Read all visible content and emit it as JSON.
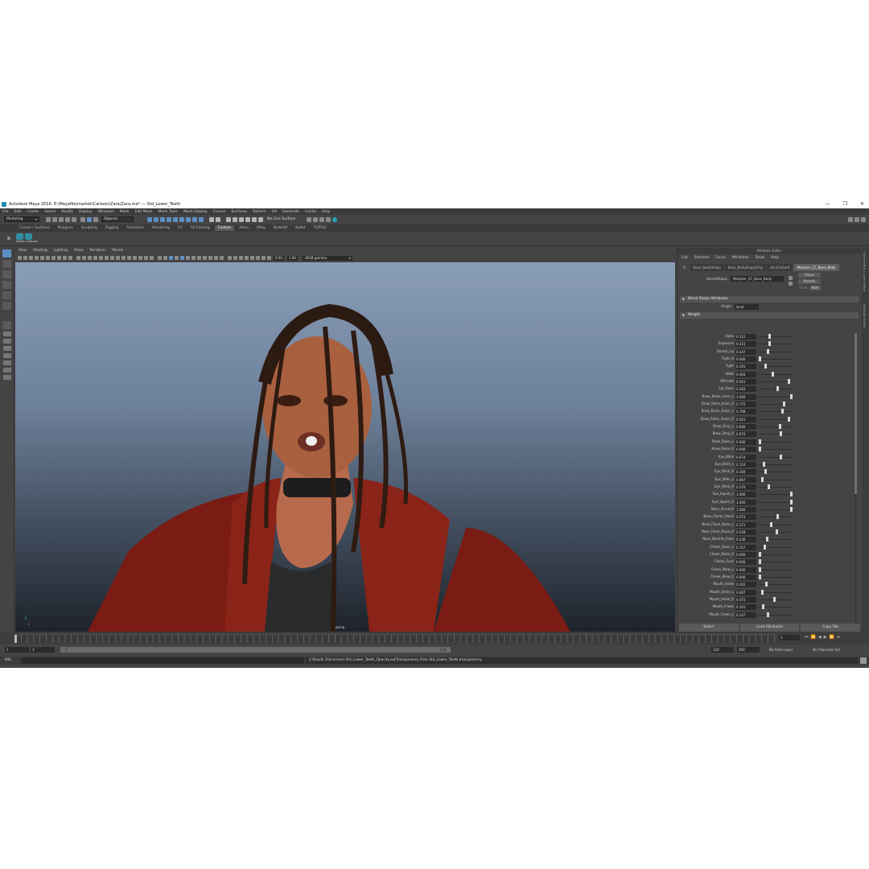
{
  "window": {
    "title": "Autodesk Maya 2016: E:\\Mayafile\\market\\Cartoon\\Zara\\Zara.ma*   ---   Std_Lower_Teeth",
    "controls": [
      "—",
      "❐",
      "✕"
    ]
  },
  "menubar": [
    "File",
    "Edit",
    "Create",
    "Select",
    "Modify",
    "Display",
    "Windows",
    "Mesh",
    "Edit Mesh",
    "Mesh Tools",
    "Mesh Display",
    "Curves",
    "Surfaces",
    "Deform",
    "UV",
    "Generate",
    "Cache",
    "Help"
  ],
  "statusline": {
    "mode": "Modeling",
    "objects": "Objects",
    "live_surface": "No Live Surface"
  },
  "shelf_tabs": [
    "Curves / Surfaces",
    "Polygons",
    "Sculpting",
    "Rigging",
    "Animation",
    "Rendering",
    "FX",
    "FX Caching",
    "Custom",
    "XGen",
    "VRay",
    "Redshift",
    "Bullet",
    "TURTLE"
  ],
  "shelf_active": "Custom",
  "shelf_button": "Select a Mouse",
  "viewport": {
    "menu": [
      "View",
      "Shading",
      "Lighting",
      "Show",
      "Renderer",
      "Panels"
    ],
    "field_a": "0.00",
    "field_b": "1.00",
    "color_mgmt": "sRGB gamma",
    "camera": "persp",
    "axis_x": "x",
    "axis_y": "y"
  },
  "attribute_editor": {
    "header": "Attribute Editor",
    "menu": [
      "List",
      "Selected",
      "Focus",
      "Attributes",
      "Show",
      "Help"
    ],
    "tabs": [
      "Base_BodyShape",
      "Base_BodyShapeOrig",
      "skinCluster4",
      "Morpher_CC_Base_Body"
    ],
    "active_tab": "Morpher_CC_Base_Body",
    "tab_prefix": "fs",
    "blendshape_label": "blendShape:",
    "blendshape_value": "Morpher_CC_Base_Body",
    "buttons": [
      "Focus",
      "Presets"
    ],
    "show_label": "Show",
    "hide_label": "Hide",
    "section_attrs": "Blend Shape Attributes",
    "origin_label": "Origin",
    "origin_value": "local",
    "section_weight": "Weight",
    "weights": [
      {
        "name": "Open",
        "value": "0.315"
      },
      {
        "name": "Explosive",
        "value": "0.315"
      },
      {
        "name": "Dental_Lip",
        "value": "0.247"
      },
      {
        "name": "Tight_O",
        "value": "0.000"
      },
      {
        "name": "Tight",
        "value": "0.191"
      },
      {
        "name": "Wide",
        "value": "0.404"
      },
      {
        "name": "Affricate",
        "value": "0.921"
      },
      {
        "name": "Lip_Open",
        "value": "0.562"
      },
      {
        "name": "Brow_Raise_Inner_L",
        "value": "1.000"
      },
      {
        "name": "Brow_Raise_Inner_R",
        "value": "0.775"
      },
      {
        "name": "Brow_Raise_Outer_L",
        "value": "0.708"
      },
      {
        "name": "Brow_Raise_Outer_R",
        "value": "0.921"
      },
      {
        "name": "Brow_Drop_L",
        "value": "0.640"
      },
      {
        "name": "Brow_Drop_R",
        "value": "0.674"
      },
      {
        "name": "Brow_Raise_L",
        "value": "0.000"
      },
      {
        "name": "Brow_Raise_R",
        "value": "0.000"
      },
      {
        "name": "Eye_Blink",
        "value": "0.674"
      },
      {
        "name": "Eye_Blink_L",
        "value": "0.124"
      },
      {
        "name": "Eye_Blink_R",
        "value": "0.169"
      },
      {
        "name": "Eye_Wide_L",
        "value": "0.067"
      },
      {
        "name": "Eye_Wide_R",
        "value": "0.270"
      },
      {
        "name": "Eye_Squint_L",
        "value": "1.000"
      },
      {
        "name": "Eye_Squint_R",
        "value": "1.000"
      },
      {
        "name": "Nose_Scrunch",
        "value": "1.000"
      },
      {
        "name": "Nose_Flanks_Raise",
        "value": "0.573"
      },
      {
        "name": "Nose_Flank_Raise_L",
        "value": "0.371"
      },
      {
        "name": "Nose_Flank_Raise_R",
        "value": "0.528"
      },
      {
        "name": "Nose_Nostrils_Flare",
        "value": "0.236"
      },
      {
        "name": "Cheek_Raise_L",
        "value": "0.157"
      },
      {
        "name": "Cheek_Raise_R",
        "value": "0.000"
      },
      {
        "name": "Cheek_Suck",
        "value": "0.000"
      },
      {
        "name": "Cheek_Blow_L",
        "value": "0.000"
      },
      {
        "name": "Cheek_Blow_R",
        "value": "0.000"
      },
      {
        "name": "Mouth_Smile",
        "value": "0.202"
      },
      {
        "name": "Mouth_Smile_L",
        "value": "0.067"
      },
      {
        "name": "Mouth_Smile_R",
        "value": "0.472"
      },
      {
        "name": "Mouth_Frown",
        "value": "0.101"
      },
      {
        "name": "Mouth_Frown_L",
        "value": "0.247"
      }
    ],
    "bottom_buttons": [
      "Select",
      "Load Attributes",
      "Copy Tab"
    ]
  },
  "side_strip": [
    "Channel Box / Layer Editor",
    "Attribute Editor"
  ],
  "timeline": {
    "current_frame": "1",
    "play_controls": [
      "⏮",
      "⏪",
      "◀",
      "▶",
      "⏩",
      "⏭"
    ]
  },
  "range": {
    "start": "1",
    "start_inner": "1",
    "slider_left": "1",
    "slider_right": "120",
    "end_inner": "120",
    "end": "200",
    "anim_layer": "No Anim Layer",
    "char_set": "No Character Set"
  },
  "cmdline": {
    "mode": "MEL",
    "result": "// Result: Disconnect Std_Lower_Teeth_Opacity.outTransparency from Std_Lower_Teeth.transparency"
  },
  "colors": {
    "accent": "#5d8fc4",
    "panel": "#444444",
    "maya_teal": "#29a7b8"
  }
}
